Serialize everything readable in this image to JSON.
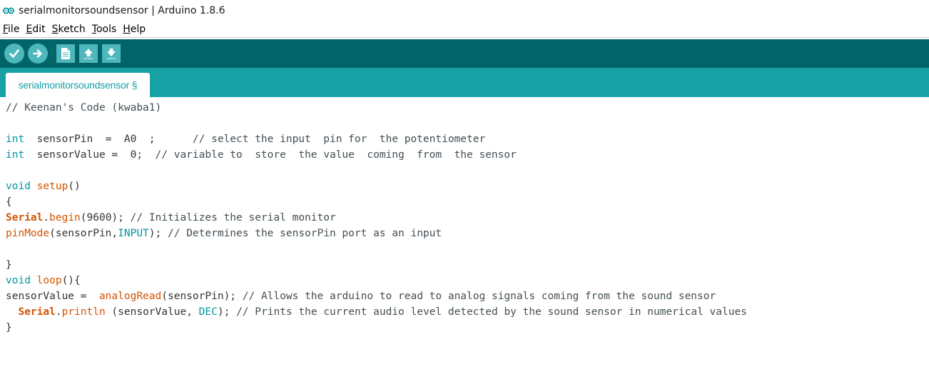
{
  "window": {
    "title": "serialmonitorsoundsensor | Arduino 1.8.6",
    "icon": "arduino-infinity-icon"
  },
  "menu": [
    {
      "acc": "F",
      "rest": "ile"
    },
    {
      "acc": "E",
      "rest": "dit"
    },
    {
      "acc": "S",
      "rest": "ketch"
    },
    {
      "acc": "T",
      "rest": "ools"
    },
    {
      "acc": "H",
      "rest": "elp"
    }
  ],
  "toolbar": {
    "buttons": [
      "verify-icon",
      "upload-icon",
      "new-icon",
      "open-icon",
      "save-icon"
    ]
  },
  "tab": {
    "label": "serialmonitorsoundsensor §"
  },
  "colors": {
    "toolbar_bg": "#006468",
    "tab_bar_bg": "#17a1a5",
    "button_bg": "#4db7bb",
    "keyword": "#00979d",
    "function": "#d35400"
  },
  "code": [
    [
      {
        "t": "// Keenan's Code (kwaba1)",
        "c": "cm"
      }
    ],
    [],
    [
      {
        "t": "int",
        "c": "kw"
      },
      {
        "t": "  sensorPin  =  A0  ;      "
      },
      {
        "t": "// select the input  pin for  the potentiometer",
        "c": "cm"
      }
    ],
    [
      {
        "t": "int",
        "c": "kw"
      },
      {
        "t": "  sensorValue =  0;  "
      },
      {
        "t": "// variable to  store  the value  coming  from  the sensor",
        "c": "cm"
      }
    ],
    [],
    [
      {
        "t": "void",
        "c": "kw"
      },
      {
        "t": " "
      },
      {
        "t": "setup",
        "c": "fn"
      },
      {
        "t": "()"
      }
    ],
    [
      {
        "t": "{"
      }
    ],
    [
      {
        "t": "Serial",
        "c": "cls"
      },
      {
        "t": "."
      },
      {
        "t": "begin",
        "c": "fn"
      },
      {
        "t": "(9600); "
      },
      {
        "t": "// Initializes the serial monitor",
        "c": "cm"
      }
    ],
    [
      {
        "t": "pinMode",
        "c": "fn"
      },
      {
        "t": "(sensorPin,"
      },
      {
        "t": "INPUT",
        "c": "const"
      },
      {
        "t": "); "
      },
      {
        "t": "// Determines the sensorPin port as an input",
        "c": "cm"
      }
    ],
    [],
    [
      {
        "t": "}"
      }
    ],
    [
      {
        "t": "void",
        "c": "kw"
      },
      {
        "t": " "
      },
      {
        "t": "loop",
        "c": "fn"
      },
      {
        "t": "(){"
      }
    ],
    [
      {
        "t": "sensorValue =  "
      },
      {
        "t": "analogRead",
        "c": "fn"
      },
      {
        "t": "(sensorPin); "
      },
      {
        "t": "// Allows the arduino to read to analog signals coming from the sound sensor",
        "c": "cm"
      }
    ],
    [
      {
        "t": "  "
      },
      {
        "t": "Serial",
        "c": "cls"
      },
      {
        "t": "."
      },
      {
        "t": "println",
        "c": "fn"
      },
      {
        "t": " (sensorValue, "
      },
      {
        "t": "DEC",
        "c": "const"
      },
      {
        "t": "); "
      },
      {
        "t": "// Prints the current audio level detected by the sound sensor in numerical values",
        "c": "cm"
      }
    ],
    [
      {
        "t": "}"
      }
    ]
  ]
}
